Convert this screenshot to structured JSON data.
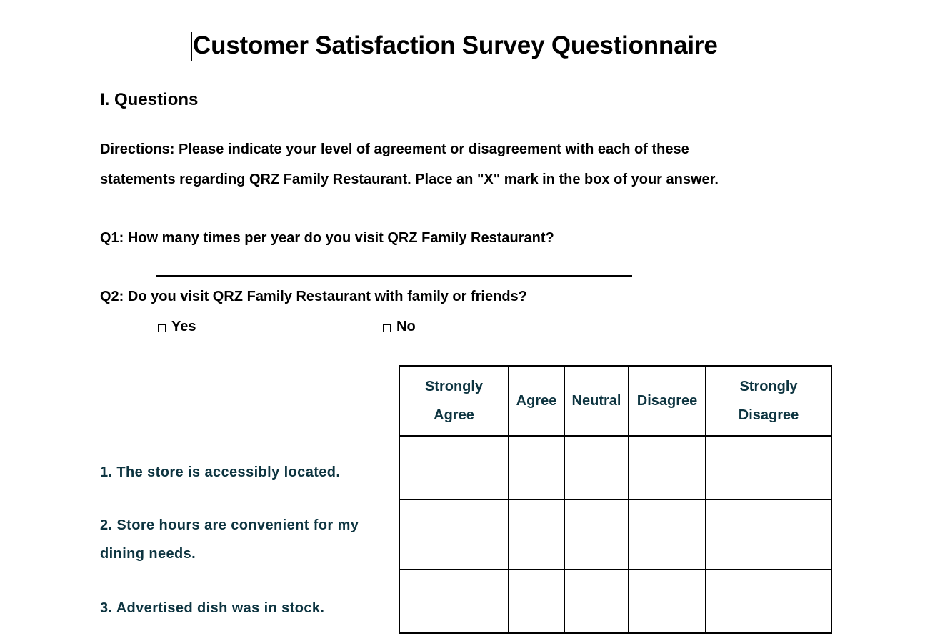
{
  "document": {
    "title": "Customer Satisfaction Survey Questionnaire",
    "section_heading": "I. Questions",
    "directions": [
      "Directions: Please indicate your level of agreement or disagreement with each of these",
      "statements regarding QRZ Family Restaurant. Place an \"X\" mark in the box of your answer."
    ],
    "q1": {
      "text": "Q1: How many times per year do you visit QRZ Family Restaurant?",
      "answer": ""
    },
    "q2": {
      "text": "Q2: Do you visit QRZ Family Restaurant with family or friends?",
      "options": [
        {
          "label": "Yes",
          "checked": false
        },
        {
          "label": "No",
          "checked": false
        }
      ]
    },
    "rating_table": {
      "columns": [
        {
          "line1": "Strongly",
          "line2": "Agree"
        },
        {
          "line1": "Agree",
          "line2": ""
        },
        {
          "line1": "Neutral",
          "line2": ""
        },
        {
          "line1": "Disagree",
          "line2": ""
        },
        {
          "line1": "Strongly",
          "line2": "Disagree"
        }
      ],
      "statements": [
        {
          "line1": "1. The store is accessibly located.",
          "line2": ""
        },
        {
          "line1": "2. Store hours are convenient for my",
          "line2": "dining needs."
        },
        {
          "line1": "3. Advertised dish was in stock.",
          "line2": ""
        }
      ]
    }
  },
  "colors": {
    "text": "#000000",
    "table_text": "#0d3440",
    "border": "#000000"
  }
}
